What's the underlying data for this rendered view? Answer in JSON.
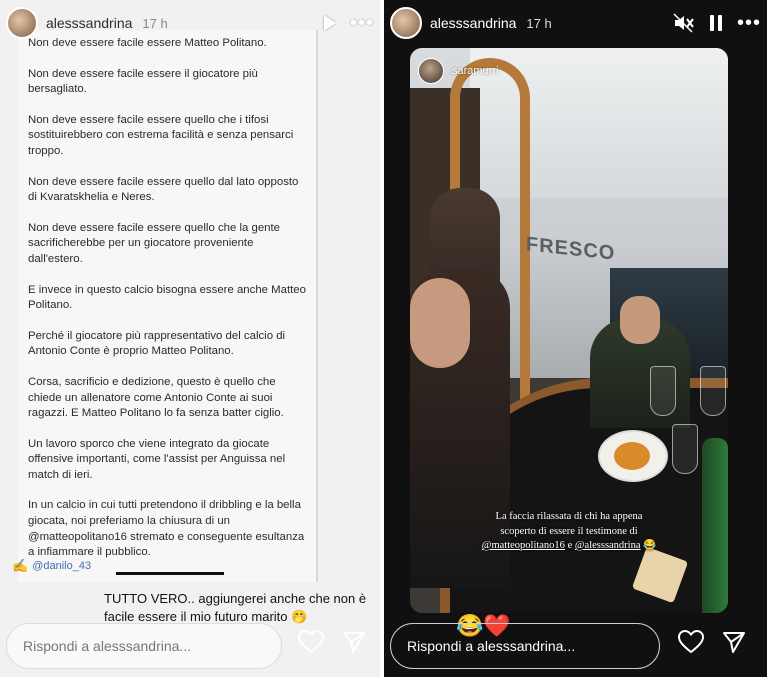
{
  "left_story": {
    "header": {
      "username": "alesssandrina",
      "time": "17 h",
      "more": "•••"
    },
    "post_paragraphs": [
      "Non deve essere facile essere Matteo Politano.",
      "Non deve essere facile essere il giocatore più bersagliato.",
      "Non deve essere facile essere quello che i tifosi sostituirebbero con estrema facilità e senza pensarci troppo.",
      "Non deve essere facile essere quello dal lato opposto di Kvaratskhelia e Neres.",
      "Non deve essere facile essere quello che la gente sacrificherebbe per un giocatore proveniente dall'estero.",
      "E invece in questo calcio bisogna essere anche Matteo Politano.",
      "Perché il giocatore più rappresentativo del calcio di Antonio Conte è proprio Matteo Politano.",
      "Corsa, sacrificio e dedizione, questo è quello che chiede un allenatore come Antonio Conte ai suoi ragazzi. E Matteo Politano lo fa senza batter ciglio.",
      "Un lavoro sporco che viene integrato da giocate offensive importanti, come l'assist per Anguissa nel match di ieri.",
      "In un calcio in cui tutti pretendono il dribbling e la bella giocata, noi preferiamo la chiusura di un @matteopolitano16 stremato e conseguente esultanza a infiammare il pubblico."
    ],
    "signature": {
      "pen": "✍️",
      "handle": "@danilo_43"
    },
    "comment": "TUTTO VERO.. aggiungerei anche che non è facile essere il mio futuro marito 🤭",
    "reply_placeholder": "Rispondi a alesssandrina..."
  },
  "right_story": {
    "header": {
      "username": "alesssandrina",
      "time": "17 h",
      "more": "•••"
    },
    "photo_username": "saramurri",
    "sign_text": "FRESCO",
    "caption_line1": "La faccia rilassata di chi ha appena",
    "caption_line2": "scoperto di essere il testimone di",
    "caption_mention1": "@matteopolitano16",
    "caption_and": " e ",
    "caption_mention2": "@alesssandrina",
    "caption_emoji": " 😂",
    "reactions": "😂❤️",
    "reply_placeholder": "Rispondi a alesssandrina..."
  },
  "colors": {
    "link": "#3f6fb5",
    "dark_bg": "#101010",
    "light_bg": "#f1f1f1"
  },
  "icons": [
    "play-icon",
    "mute-icon",
    "pause-icon",
    "heart-icon",
    "send-icon",
    "more-icon"
  ]
}
